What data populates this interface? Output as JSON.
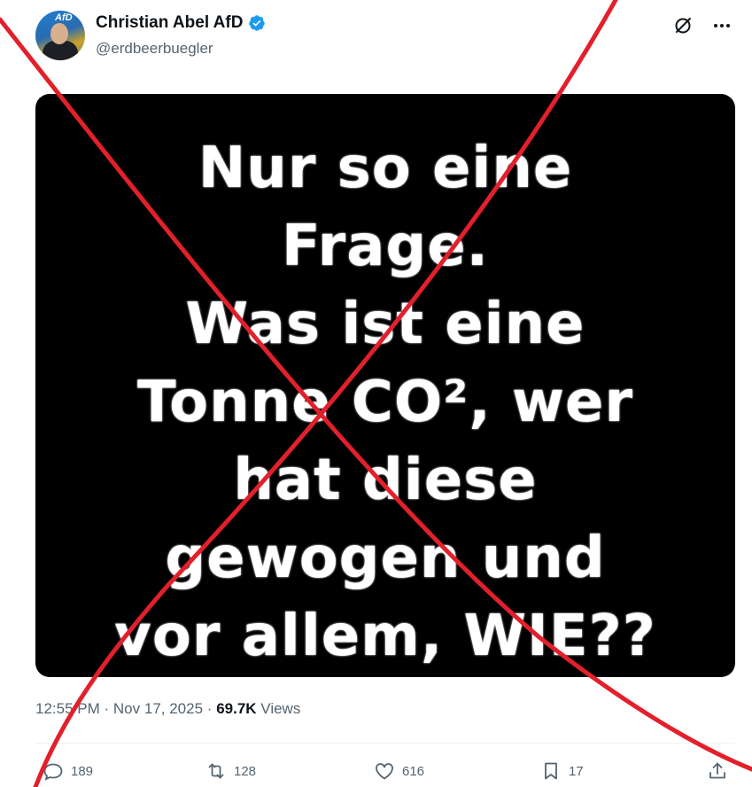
{
  "author": {
    "name": "Christian Abel AfD",
    "handle": "@erdbeerbuegler",
    "avatar_badge": "AfD",
    "verified_color": "#1d9bf0"
  },
  "header_icons": [
    "grok-icon",
    "more-icon"
  ],
  "media": {
    "lines": [
      "Nur so eine",
      "Frage.",
      "Was ist eine",
      "Tonne CO², wer",
      "hat diese",
      "gewogen und",
      "vor allem, WIE??"
    ]
  },
  "meta": {
    "time": "12:55 PM",
    "separator": "·",
    "date": "Nov 17, 2025",
    "separator2": "·",
    "views_count": "69.7K",
    "views_label": "Views"
  },
  "actions": {
    "replies": "189",
    "reposts": "128",
    "likes": "616",
    "bookmarks": "17"
  },
  "overlay": {
    "cross_color": "#e2202b"
  }
}
